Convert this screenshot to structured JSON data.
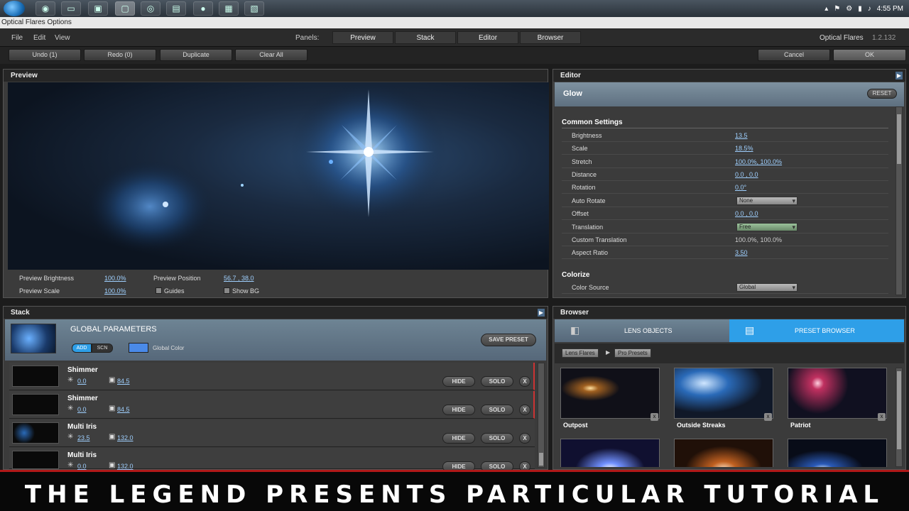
{
  "taskbar": {
    "time": "4:55 PM"
  },
  "window_title": "Optical Flares Options",
  "menu": {
    "file": "File",
    "edit": "Edit",
    "view": "View",
    "panels_label": "Panels:",
    "product": "Optical Flares",
    "version": "1.2.132"
  },
  "panel_tabs": [
    "Preview",
    "Stack",
    "Editor",
    "Browser"
  ],
  "toolbar": {
    "undo": "Undo (1)",
    "redo": "Redo (0)",
    "duplicate": "Duplicate",
    "clear_all": "Clear All",
    "cancel": "Cancel",
    "ok": "OK"
  },
  "preview": {
    "title": "Preview",
    "brightness_label": "Preview Brightness",
    "brightness_value": "100.0%",
    "scale_label": "Preview Scale",
    "scale_value": "100.0%",
    "position_label": "Preview Position",
    "position_value": "56.7 , 38.0",
    "guides_label": "Guides",
    "show_bg_label": "Show BG"
  },
  "editor": {
    "title": "Editor",
    "object_name": "Glow",
    "reset_label": "RESET",
    "common_settings": "Common Settings",
    "rows": [
      {
        "label": "Brightness",
        "value": "13.5"
      },
      {
        "label": "Scale",
        "value": "18.5%"
      },
      {
        "label": "Stretch",
        "value": "100.0%, 100.0%"
      },
      {
        "label": "Distance",
        "value": "0.0 , 0.0"
      },
      {
        "label": "Rotation",
        "value": "0.0°"
      },
      {
        "label": "Auto Rotate",
        "value": "None"
      },
      {
        "label": "Offset",
        "value": "0.0 , 0.0"
      },
      {
        "label": "Translation",
        "value": "Free"
      },
      {
        "label": "Custom Translation",
        "value": "100.0%, 100.0%"
      },
      {
        "label": "Aspect Ratio",
        "value": "3.50"
      }
    ],
    "colorize": "Colorize",
    "color_source_label": "Color Source",
    "color_source_value": "Global"
  },
  "stack": {
    "title": "Stack",
    "global_title": "GLOBAL PARAMETERS",
    "add_label": "ADD",
    "scn_label": "SCN",
    "global_color_label": "Global Color",
    "save_preset": "SAVE PRESET",
    "hide_label": "HIDE",
    "solo_label": "SOLO",
    "x_label": "X",
    "items": [
      {
        "name": "Shimmer",
        "v1": "0.0",
        "v2": "84.5"
      },
      {
        "name": "Shimmer",
        "v1": "0.0",
        "v2": "84.5"
      },
      {
        "name": "Multi Iris",
        "v1": "23.5",
        "v2": "132.0"
      },
      {
        "name": "Multi Iris",
        "v1": "0.0",
        "v2": "132.0"
      }
    ]
  },
  "browser": {
    "title": "Browser",
    "lens_objects": "LENS OBJECTS",
    "preset_browser": "PRESET BROWSER",
    "crumbs": [
      "Lens Flares",
      "Pro Presets"
    ],
    "presets": [
      "Outpost",
      "Outside Streaks",
      "Patriot",
      "",
      "",
      ""
    ]
  },
  "banner": "THE LEGEND PRESENTS PARTICULAR TUTORIAL",
  "colors": {
    "accent": "#2e9fe8",
    "link": "#9fd0ff",
    "banner_red": "#b01818"
  }
}
